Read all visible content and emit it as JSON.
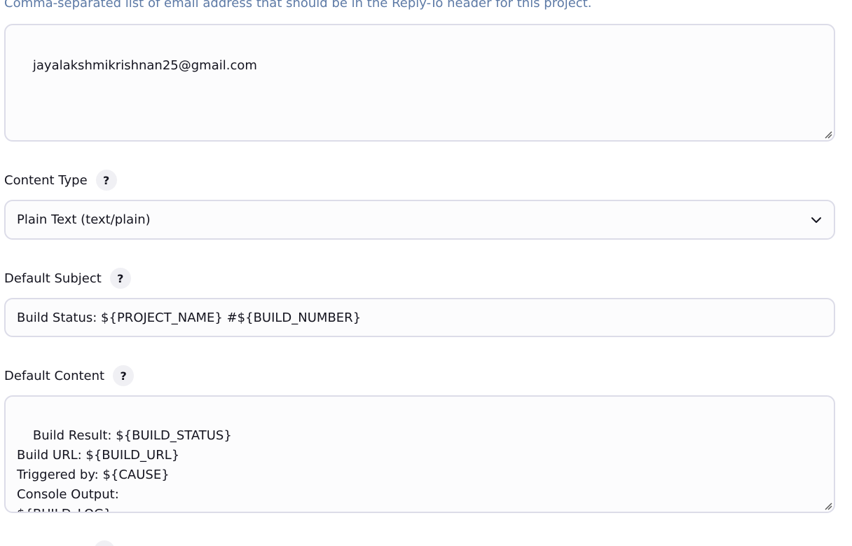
{
  "reply_to": {
    "hint": "Comma-separated list of email address that should be in the Reply-To header for this project.",
    "value": "jayalakshmikrishnan25@gmail.com"
  },
  "content_type": {
    "label": "Content Type",
    "help": "?",
    "selected": "Plain Text (text/plain)",
    "icon": "chevron-down-icon"
  },
  "default_subject": {
    "label": "Default Subject",
    "help": "?",
    "value": "Build Status: ${PROJECT_NAME} #${BUILD_NUMBER}"
  },
  "default_content": {
    "label": "Default Content",
    "help": "?",
    "value": "Build Result: ${BUILD_STATUS}\nBuild URL: ${BUILD_URL}\nTriggered by: ${CAUSE}\nConsole Output:\n${BUILD_LOG}"
  },
  "colors": {
    "hint_text": "#5d7aa6",
    "field_border": "#dcdce8",
    "field_background": "#fcfcfd",
    "help_background": "#f0f0f4"
  }
}
